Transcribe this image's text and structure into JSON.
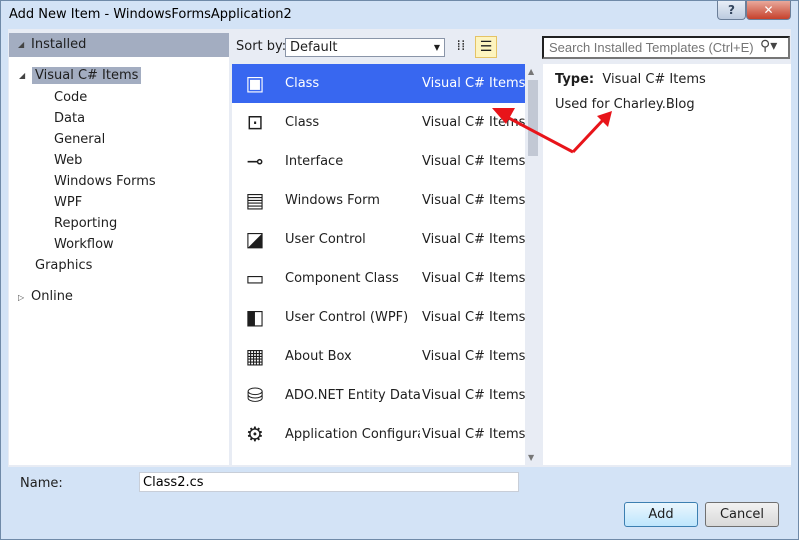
{
  "window": {
    "title": "Add New Item - WindowsFormsApplication2",
    "help": "?",
    "close": "✕"
  },
  "tree": {
    "installed": "Installed",
    "visual_cs": "Visual C# Items",
    "children": [
      "Code",
      "Data",
      "General",
      "Web",
      "Windows Forms",
      "WPF",
      "Reporting",
      "Workflow"
    ],
    "graphics": "Graphics",
    "online": "Online"
  },
  "toolbar": {
    "sort_label": "Sort by:",
    "sort_value": "Default",
    "view_medium_icon": "grid-icon",
    "view_list_icon": "list-icon"
  },
  "search": {
    "placeholder": "Search Installed Templates (Ctrl+E)"
  },
  "templates": [
    {
      "name": "Class",
      "category": "Visual C# Items",
      "icon": "▣",
      "selected": true
    },
    {
      "name": "Class",
      "category": "Visual C# Items",
      "icon": "⊡"
    },
    {
      "name": "Interface",
      "category": "Visual C# Items",
      "icon": "⊸"
    },
    {
      "name": "Windows Form",
      "category": "Visual C# Items",
      "icon": "▤"
    },
    {
      "name": "User Control",
      "category": "Visual C# Items",
      "icon": "◪"
    },
    {
      "name": "Component Class",
      "category": "Visual C# Items",
      "icon": "▭"
    },
    {
      "name": "User Control (WPF)",
      "category": "Visual C# Items",
      "icon": "◧"
    },
    {
      "name": "About Box",
      "category": "Visual C# Items",
      "icon": "▦"
    },
    {
      "name": "ADO.NET Entity Data...",
      "category": "Visual C# Items",
      "icon": "⛁"
    },
    {
      "name": "Application Configura...",
      "category": "Visual C# Items",
      "icon": "⚙"
    }
  ],
  "details": {
    "type_label": "Type:",
    "type_value": "Visual C# Items",
    "description": "Used for Charley.Blog"
  },
  "footer": {
    "name_label": "Name:",
    "name_value": "Class2.cs",
    "add": "Add",
    "cancel": "Cancel"
  },
  "colors": {
    "selection": "#3867f0",
    "annotation_arrow": "#e8141a"
  }
}
